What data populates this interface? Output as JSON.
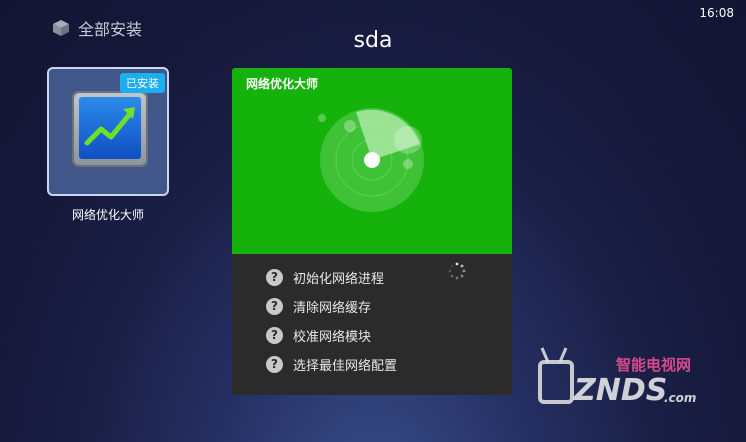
{
  "header": {
    "section_title": "全部安装",
    "icon": "cube-icon"
  },
  "status_bar": {
    "time": "16:08"
  },
  "page": {
    "title": "sda"
  },
  "app": {
    "name": "网络优化大师",
    "badge": "已安装",
    "icon": "network-optimizer-icon"
  },
  "dialog": {
    "title": "网络优化大师",
    "steps": [
      {
        "label": "初始化网络进程",
        "status": "loading"
      },
      {
        "label": "清除网络缓存",
        "status": "pending"
      },
      {
        "label": "校准网络模块",
        "status": "pending"
      },
      {
        "label": "选择最佳网络配置",
        "status": "pending"
      }
    ],
    "colors": {
      "accent": "#15b20b",
      "panel": "#2b2b2b"
    }
  },
  "watermark": {
    "brand": "ZNDS",
    "subtitle": "智能电视网",
    "domain": ".com"
  }
}
